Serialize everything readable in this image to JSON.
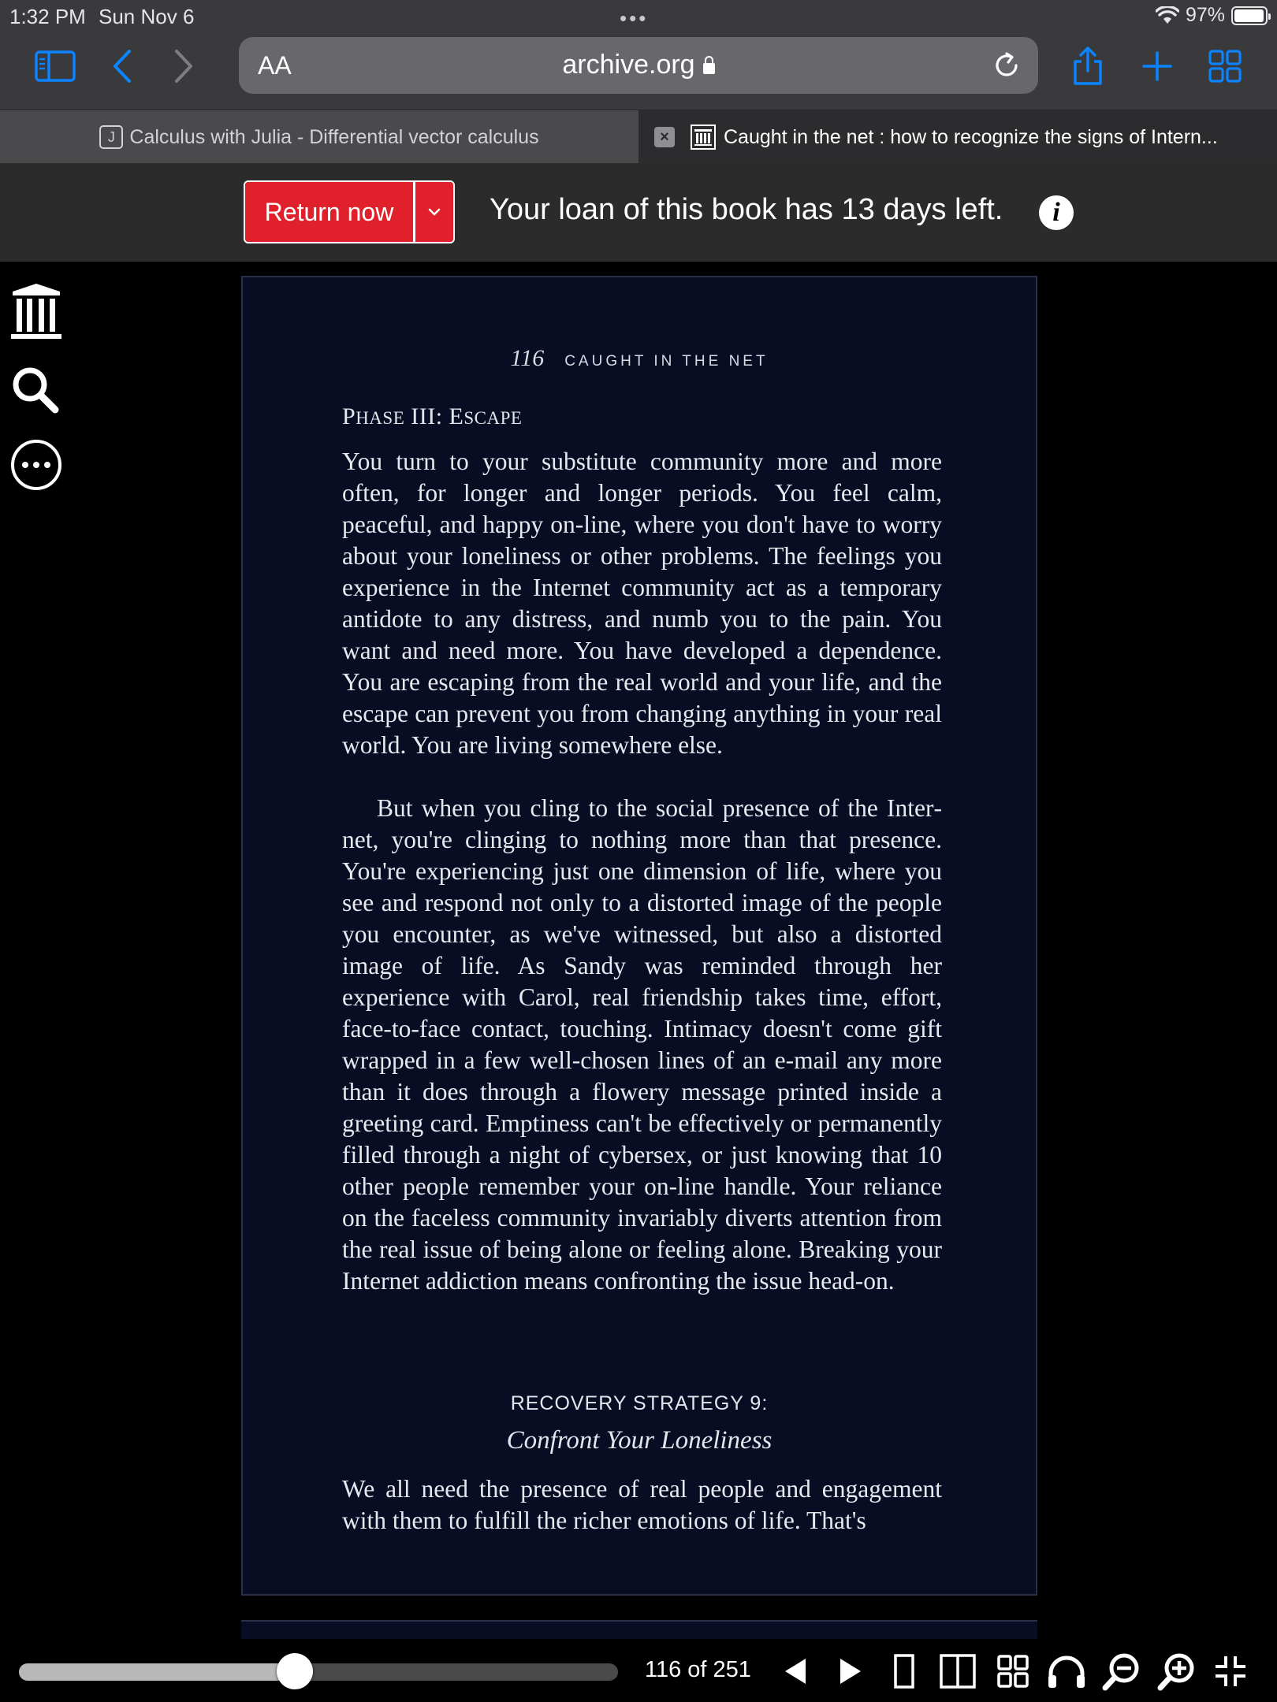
{
  "status_bar": {
    "time": "1:32 PM",
    "date": "Sun Nov 6",
    "battery": "97%",
    "battery_level": 0.97
  },
  "browser": {
    "reader_label": "AA",
    "url": "archive.org",
    "tabs": [
      {
        "label": "Calculus with Julia - Differential vector calculus",
        "favicon": "J",
        "active": false
      },
      {
        "label": "Caught in the net : how to recognize the signs of Intern...",
        "active": true
      }
    ]
  },
  "loan": {
    "return_label": "Return now",
    "message": "Your loan of this book has 13 days left."
  },
  "book": {
    "page_number": "116",
    "running_head": "CAUGHT IN THE NET",
    "section_title_p": "P",
    "section_title_hase": "HASE",
    "section_title_iii": " III: E",
    "section_title_scape": "SCAPE",
    "para1": "You turn to your substitute community more and more often, for longer and longer periods. You feel calm, peaceful, and happy on-line, where you don't have to worry about your loneliness or other problems. The feel­ings you experience in the Internet community act as a temporary antidote to any distress, and numb you to the pain. You want and need more. You have developed a de­pendence. You are escaping from the real world and your life, and the escape can prevent you from changing anything in your real world. You are living somewhere else.",
    "para2": "But when you cling to the social presence of the Inter­net, you're clinging to nothing more than that presence. You're experiencing just one dimension of life, where you see and respond not only to a distorted image of the people you encounter, as we've witnessed, but also a dis­torted image of life. As Sandy was reminded through her experience with Carol, real friendship takes time, effort, face-to-face contact, touching. Intimacy doesn't come gift wrapped in a few well-chosen lines of an e-mail any more than it does through a flowery message printed inside a greeting card. Emptiness can't be effectively or perma­nently filled through a night of cybersex, or just knowing that 10 other people remember your on-line handle. Your reliance on the faceless community invariably diverts attention from the real issue of being alone or feeling alone. Breaking your Internet addiction means confronting the issue head-on.",
    "strategy_label": "RECOVERY STRATEGY 9:",
    "strategy_title": "Confront Your Loneliness",
    "para3": "We all need the presence of real people and engagement with them to fulfill the richer emotions of life. That's"
  },
  "navigation": {
    "page_display": "116 of 251",
    "current_page": 116,
    "total_pages": 251
  },
  "colors": {
    "accent_red": "#e0202a",
    "page_background": "#080d24",
    "chrome": "#3a3a3c",
    "link_blue": "#0a84ff"
  }
}
